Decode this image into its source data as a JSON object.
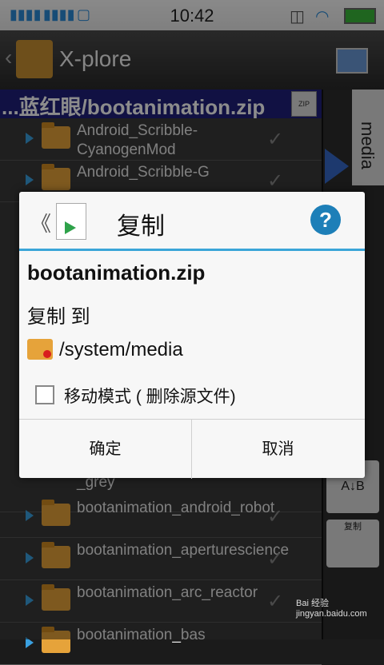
{
  "status_bar": {
    "time": "10:42"
  },
  "app_bar": {
    "title": "X-plore",
    "path": "...蓝红眼/bootanimation.zip",
    "zip_label": "ZIP"
  },
  "media_tab": {
    "label": "media"
  },
  "file_list": {
    "items": [
      {
        "name": "Android_Scribble-CyanogenMod"
      },
      {
        "name": "Android_Scribble-G"
      },
      {
        "name": "_grey"
      },
      {
        "name": "bootanimation_android_robot"
      },
      {
        "name": "bootanimation_aperturescience"
      },
      {
        "name": "bootanimation_arc_reactor"
      },
      {
        "name": "bootanimation_bas"
      }
    ]
  },
  "side_buttons": {
    "copy_label": "复制"
  },
  "dialog": {
    "title": "复制",
    "help": "?",
    "file_name": "bootanimation.zip",
    "copy_to_label": "复制 到",
    "destination": "/system/media",
    "move_mode_label": "移动模式 ( 删除源文件)",
    "ok_button": "确定",
    "cancel_button": "取消"
  },
  "watermark": "Bai 经验 jingyan.baidu.com",
  "colors": {
    "accent": "#3aa5d8",
    "folder": "#e6a33a",
    "path_bar": "#1f1f7a",
    "help": "#1d7fb8"
  }
}
